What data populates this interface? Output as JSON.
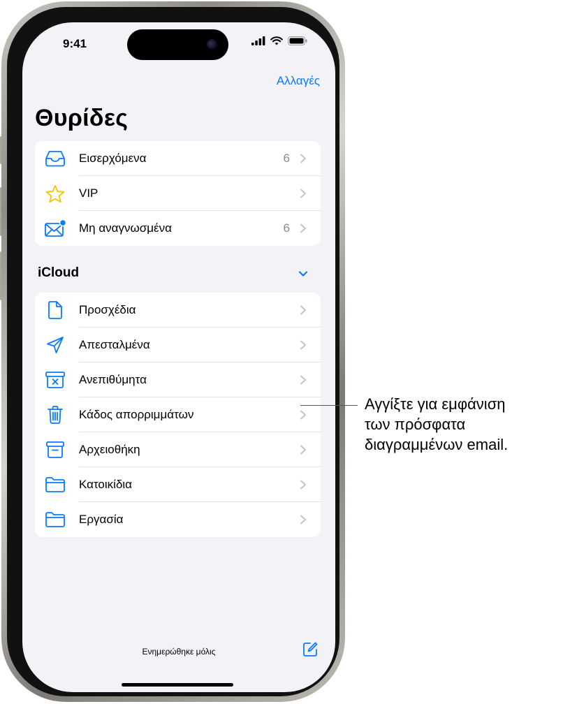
{
  "status_bar": {
    "time": "9:41"
  },
  "nav": {
    "edit_label": "Αλλαγές"
  },
  "page_title": "Θυρίδες",
  "mailboxes": [
    {
      "icon": "inbox-icon",
      "label": "Εισερχόμενα",
      "count": "6"
    },
    {
      "icon": "star-icon",
      "label": "VIP",
      "count": ""
    },
    {
      "icon": "unread-envelope-icon",
      "label": "Μη αναγνωσμένα",
      "count": "6"
    }
  ],
  "icloud": {
    "section_label": "iCloud",
    "folders": [
      {
        "icon": "document-icon",
        "label": "Προσχέδια"
      },
      {
        "icon": "paperplane-icon",
        "label": "Απεσταλμένα"
      },
      {
        "icon": "junk-icon",
        "label": "Ανεπιθύμητα"
      },
      {
        "icon": "trash-icon",
        "label": "Κάδος απορριμμάτων"
      },
      {
        "icon": "archive-icon",
        "label": "Αρχειοθήκη"
      },
      {
        "icon": "folder-icon",
        "label": "Κατοικίδια"
      },
      {
        "icon": "folder-icon",
        "label": "Εργασία"
      }
    ]
  },
  "toolbar": {
    "status_text": "Ενημερώθηκε μόλις"
  },
  "callout": {
    "text": "Αγγίξτε για εμφάνιση\nτων πρόσφατα\nδιαγραμμένων email."
  },
  "colors": {
    "accent": "#0a7aff",
    "vip_star": "#f5c400",
    "background": "#f2f2f7"
  }
}
